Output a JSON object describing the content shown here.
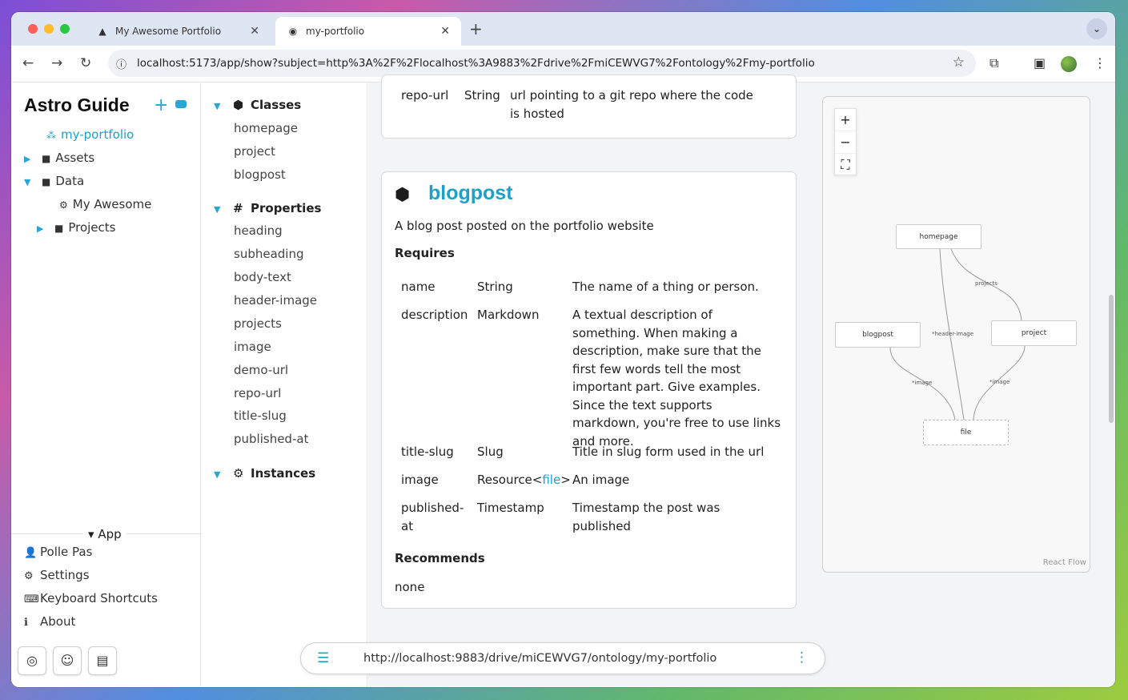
{
  "browser": {
    "tabs": [
      {
        "label": "My Awesome Portfolio",
        "icon": "astro-icon"
      },
      {
        "label": "my-portfolio",
        "icon": "atomic-icon"
      }
    ],
    "address": "localhost:5173/app/show?subject=http%3A%2F%2Flocalhost%3A9883%2Fdrive%2FmiCEWVG7%2Fontology%2Fmy-portfolio"
  },
  "sidebar": {
    "title": "Astro Guide",
    "tree": [
      {
        "label": "my-portfolio",
        "icon": "ontology-icon",
        "active": true
      },
      {
        "label": "Assets",
        "icon": "folder-icon"
      },
      {
        "label": "Data",
        "icon": "folder-icon"
      },
      {
        "label": "My Awesome",
        "icon": "gear-icon"
      },
      {
        "label": "Projects",
        "icon": "folder-icon"
      }
    ],
    "app_label": "App",
    "links": [
      {
        "label": "Polle Pas",
        "icon": "user-icon"
      },
      {
        "label": "Settings",
        "icon": "gear-icon"
      },
      {
        "label": "Keyboard Shortcuts",
        "icon": "keyboard-icon"
      },
      {
        "label": "About",
        "icon": "info-icon"
      }
    ]
  },
  "ontology_nav": {
    "classes_title": "Classes",
    "classes": [
      "homepage",
      "project",
      "blogpost"
    ],
    "properties_title": "Properties",
    "properties": [
      "heading",
      "subheading",
      "body-text",
      "header-image",
      "projects",
      "image",
      "demo-url",
      "repo-url",
      "title-slug",
      "published-at"
    ],
    "instances_title": "Instances"
  },
  "prev_card": {
    "name": "repo-url",
    "type": "String",
    "description": "url pointing to a git repo where the code is hosted"
  },
  "card": {
    "title": "blogpost",
    "description": "A blog post posted on the portfolio website",
    "requires_title": "Requires",
    "rows": [
      {
        "name": "name",
        "type": "String",
        "desc": "The name of a thing or person."
      },
      {
        "name": "description",
        "type": "Markdown",
        "desc": "A textual description of something. When making a description, make sure that the first few words tell the most important part. Give examples. Since the text supports markdown, you're free to use links and more."
      },
      {
        "name": "title-slug",
        "type": "Slug",
        "desc": "Title in slug form used in the url"
      },
      {
        "name": "image",
        "type_prefix": "Resource<",
        "type_link": "file",
        "type_suffix": ">",
        "desc": "An image"
      },
      {
        "name": "published-at",
        "type": "Timestamp",
        "desc": "Timestamp the post was published"
      }
    ],
    "recommends_title": "Recommends",
    "recommends": "none"
  },
  "graph": {
    "nodes": [
      "homepage",
      "blogpost",
      "project",
      "file"
    ],
    "edges": [
      "projects",
      "*header-image",
      "*image",
      "*image"
    ],
    "credit": "React Flow"
  },
  "bottom_bar": {
    "url": "http://localhost:9883/drive/miCEWVG7/ontology/my-portfolio"
  }
}
